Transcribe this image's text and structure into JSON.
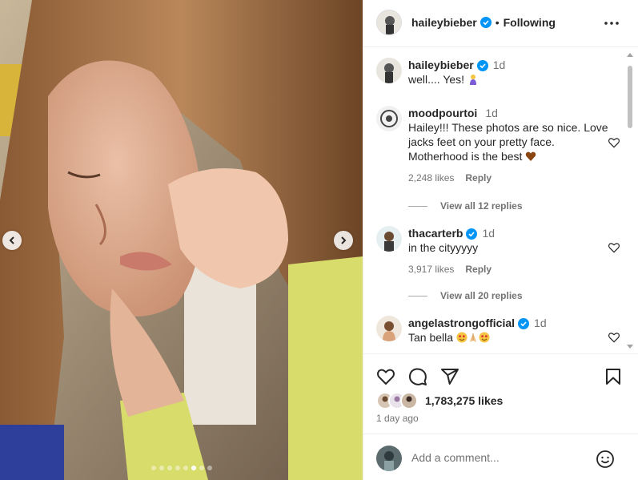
{
  "post": {
    "username": "haileybieber",
    "follow_label": "Following",
    "separator": "•",
    "caption": {
      "username": "haileybieber",
      "time": "1d",
      "text": "well.... Yes! "
    },
    "carousel": {
      "slide_count": 8,
      "active_index": 5
    }
  },
  "comments": [
    {
      "username": "moodpourtoi",
      "time": "1d",
      "text": "Hailey!!! These photos are so nice. Love jacks feet on your pretty face. Motherhood is the best ",
      "likes": "2,248 likes",
      "reply_label": "Reply",
      "view_replies": "View all 12 replies"
    },
    {
      "username": "thacarterb",
      "time": "1d",
      "text": "in the cityyyyy",
      "likes": "3,917 likes",
      "reply_label": "Reply",
      "view_replies": "View all 20 replies"
    },
    {
      "username": "angelastrongofficial",
      "time": "1d",
      "text": "Tan bella "
    }
  ],
  "likes": {
    "count_text": "1,783,275 likes"
  },
  "posted": "1 day ago",
  "composer": {
    "placeholder": "Add a comment..."
  },
  "colors": {
    "verified": "#0095f6",
    "heart": "#8b4513",
    "text": "#262626",
    "secondary": "#737373"
  },
  "icons": [
    "heart-icon",
    "comment-icon",
    "share-icon",
    "bookmark-icon",
    "more-icon",
    "emoji-icon",
    "verified-icon"
  ]
}
